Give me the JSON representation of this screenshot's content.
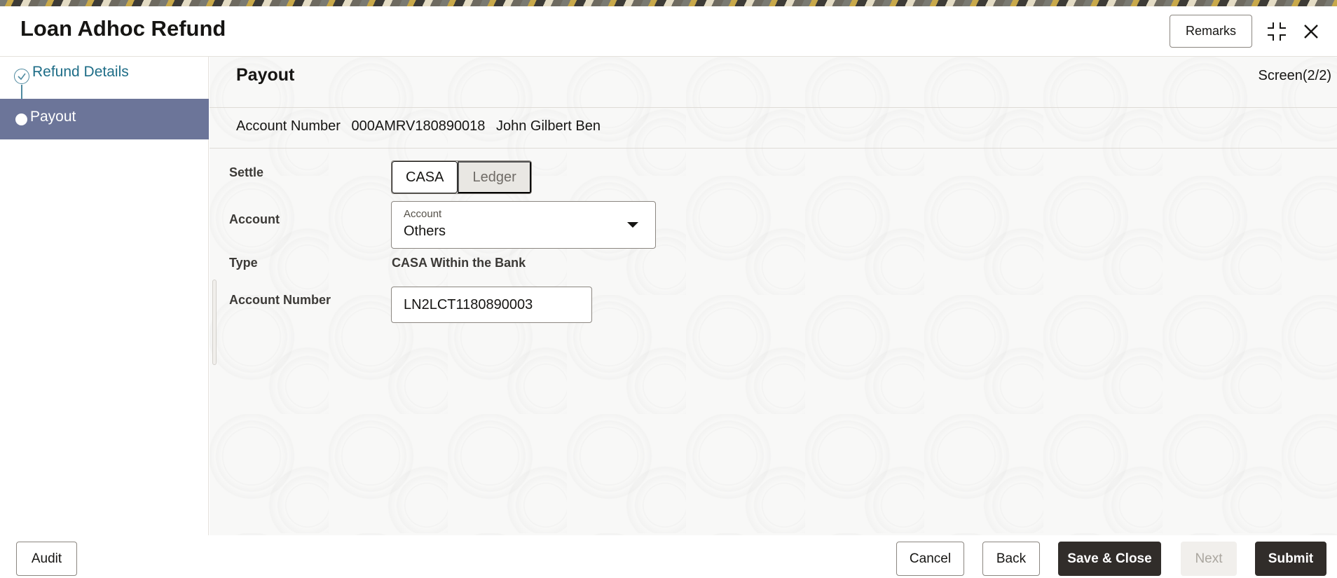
{
  "header": {
    "title": "Loan Adhoc Refund",
    "remarks_label": "Remarks",
    "icons": [
      "collapse-icon",
      "close-icon"
    ]
  },
  "sidebar": {
    "steps": [
      {
        "label": "Refund Details",
        "state": "completed"
      },
      {
        "label": "Payout",
        "state": "active"
      }
    ]
  },
  "main": {
    "section_title": "Payout",
    "screen_indicator": "Screen(2/2)",
    "account_info": {
      "label": "Account Number",
      "number": "000AMRV180890018",
      "name": "John Gilbert Ben"
    },
    "fields": {
      "settle_label": "Settle",
      "settle_options": [
        "CASA",
        "Ledger"
      ],
      "settle_selected": "CASA",
      "account_label": "Account",
      "account_select_label": "Account",
      "account_value": "Others",
      "type_label": "Type",
      "type_value": "CASA Within the Bank",
      "account_number_label": "Account Number",
      "account_number_value": "LN2LCT1180890003"
    }
  },
  "footer": {
    "audit": "Audit",
    "cancel": "Cancel",
    "back": "Back",
    "save_close": "Save & Close",
    "next": "Next",
    "submit": "Submit"
  },
  "colors": {
    "active_step_bg": "#6c7599",
    "completed_step_text": "#1e6d87",
    "primary_button": "#312d2a"
  }
}
